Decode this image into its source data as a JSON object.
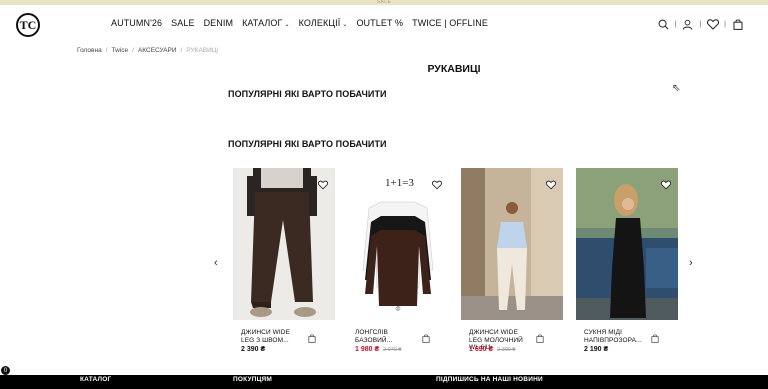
{
  "topbar": {
    "text": "SALE"
  },
  "header": {
    "logo_text": "TC",
    "nav": [
      {
        "label": "AUTUMN'26",
        "has_dropdown": false
      },
      {
        "label": "SALE",
        "has_dropdown": false
      },
      {
        "label": "DENIM",
        "has_dropdown": false
      },
      {
        "label": "КАТАЛОГ",
        "has_dropdown": true
      },
      {
        "label": "КОЛЕКЦІЇ",
        "has_dropdown": true
      },
      {
        "label": "OUTLET %",
        "has_dropdown": false
      },
      {
        "label": "TWICE | OFFLINE",
        "has_dropdown": false
      }
    ],
    "icons": [
      "search-icon",
      "user-icon",
      "heart-icon",
      "bag-icon"
    ]
  },
  "breadcrumbs": [
    "Головна",
    "Twice",
    "АКСЕСУАРИ",
    "РУКАВИЦІ"
  ],
  "page_title": "РУКАВИЦІ",
  "sections": {
    "first_title": "ПОПУЛЯРНІ ЯКІ ВАРТО ПОБАЧИТИ",
    "second_title": "ПОПУЛЯРНІ ЯКІ ВАРТО ПОБАЧИТИ"
  },
  "carousel": {
    "prev_label": "‹",
    "next_label": "›",
    "products": [
      {
        "name": "ДЖИНСИ WIDE LEG З ШВОМ...",
        "price": "2 390 ₴",
        "old_price": "",
        "sale": false,
        "image": "brown-wide-jeans"
      },
      {
        "name": "ЛОНГСЛІВ БАЗОВИЙ...",
        "price": "1 980 ₴",
        "old_price": "2 970 ₴",
        "sale": true,
        "image_text": "1+1=3",
        "image": "black-longsleeves"
      },
      {
        "name": "ДЖИНСИ WIDE LEG МОЛОЧНИЙ WL 611",
        "price": "1 690 ₴",
        "old_price": "2 300 ₴",
        "sale": true,
        "image": "white-jeans-model"
      },
      {
        "name": "СУКНЯ МІДІ НАПІВПРОЗОРА...",
        "price": "2 190 ₴",
        "old_price": "",
        "sale": false,
        "image": "black-dress-model"
      }
    ]
  },
  "footer": {
    "col1": "КАТАЛОГ",
    "col2": "ПОКУПЦЯМ",
    "col3": "ПІДПИШИСЬ НА НАШІ НОВИНИ"
  },
  "badge": "0",
  "colors": {
    "sale": "#c8102e",
    "topbar": "#e9e4c4",
    "footer": "#000000"
  }
}
